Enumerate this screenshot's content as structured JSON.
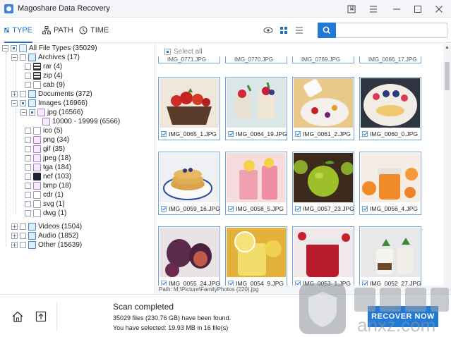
{
  "window": {
    "title": "Magoshare Data Recovery",
    "controls": [
      "bookmark-icon",
      "menu-icon",
      "minimize-icon",
      "maximize-icon",
      "close-icon"
    ]
  },
  "toolbar": {
    "tabs": [
      {
        "label": "TYPE",
        "icon": "type-grid-icon",
        "active": true
      },
      {
        "label": "PATH",
        "icon": "path-tree-icon",
        "active": false
      },
      {
        "label": "TIME",
        "icon": "clock-icon",
        "active": false
      }
    ],
    "view_modes": [
      "preview-eye-icon",
      "grid-view-icon",
      "list-view-icon"
    ],
    "search": {
      "icon": "search-icon",
      "placeholder": "",
      "value": ""
    }
  },
  "tree": {
    "root": {
      "label": "All File Types (35029)"
    },
    "archives": {
      "label": "Archives (17)"
    },
    "rar": {
      "label": "rar (4)"
    },
    "zip": {
      "label": "zip (4)"
    },
    "cab": {
      "label": "cab (9)"
    },
    "documents": {
      "label": "Documents (372)"
    },
    "images": {
      "label": "Images (16966)"
    },
    "jpg": {
      "label": "jpg (16566)"
    },
    "jpg_range": {
      "label": "10000 - 19999 (6566)"
    },
    "ico": {
      "label": "ico (5)"
    },
    "png": {
      "label": "png (34)"
    },
    "gif": {
      "label": "gif (35)"
    },
    "jpeg": {
      "label": "jpeg (18)"
    },
    "tga": {
      "label": "tga (184)"
    },
    "nef": {
      "label": "nef (103)"
    },
    "bmp": {
      "label": "bmp (18)"
    },
    "cdr": {
      "label": "cdr (1)"
    },
    "svg": {
      "label": "svg (1)"
    },
    "dwg": {
      "label": "dwg (1)"
    },
    "videos": {
      "label": "Videos (1504)"
    },
    "audio": {
      "label": "Audio (1852)"
    },
    "other": {
      "label": "Other (15639)"
    }
  },
  "content": {
    "select_all": "Select all",
    "top_strip": [
      "IMG_0771.JPG",
      "IMG_0770.JPG",
      "IMG_0769.JPG",
      "IMG_0066_17.JPG"
    ],
    "cards": [
      {
        "name": "IMG_0065_1.JPG",
        "checked": true
      },
      {
        "name": "IMG_0064_19.JPG",
        "checked": true
      },
      {
        "name": "IMG_0061_2.JPG",
        "checked": true
      },
      {
        "name": "IMG_0060_0.JPG",
        "checked": true
      },
      {
        "name": "IMG_0059_16.JPG",
        "checked": true
      },
      {
        "name": "IMG_0058_5.JPG",
        "checked": true
      },
      {
        "name": "IMG_0057_23.JPG",
        "checked": true
      },
      {
        "name": "IMG_0056_4.JPG",
        "checked": true
      },
      {
        "name": "IMG_0055_24.JPG",
        "checked": true
      },
      {
        "name": "IMG_0054_9.JPG",
        "checked": true
      },
      {
        "name": "IMG_0053_1.JPG",
        "checked": true
      },
      {
        "name": "IMG_0052_27.JPG",
        "checked": true
      }
    ],
    "path": "Path:      M:\\Picture\\FamilyPhotos (220).jpg"
  },
  "status": {
    "title": "Scan completed",
    "found": "35029 files (230.76 GB) have been found.",
    "selected": "You have selected: 19.93 MB in 16 file(s)"
  },
  "actions": {
    "recover": "RECOVER NOW"
  },
  "watermark": {
    "text": "anxz.com"
  },
  "colors": {
    "accent": "#2279d4",
    "card_border": "#6ea3dc"
  }
}
